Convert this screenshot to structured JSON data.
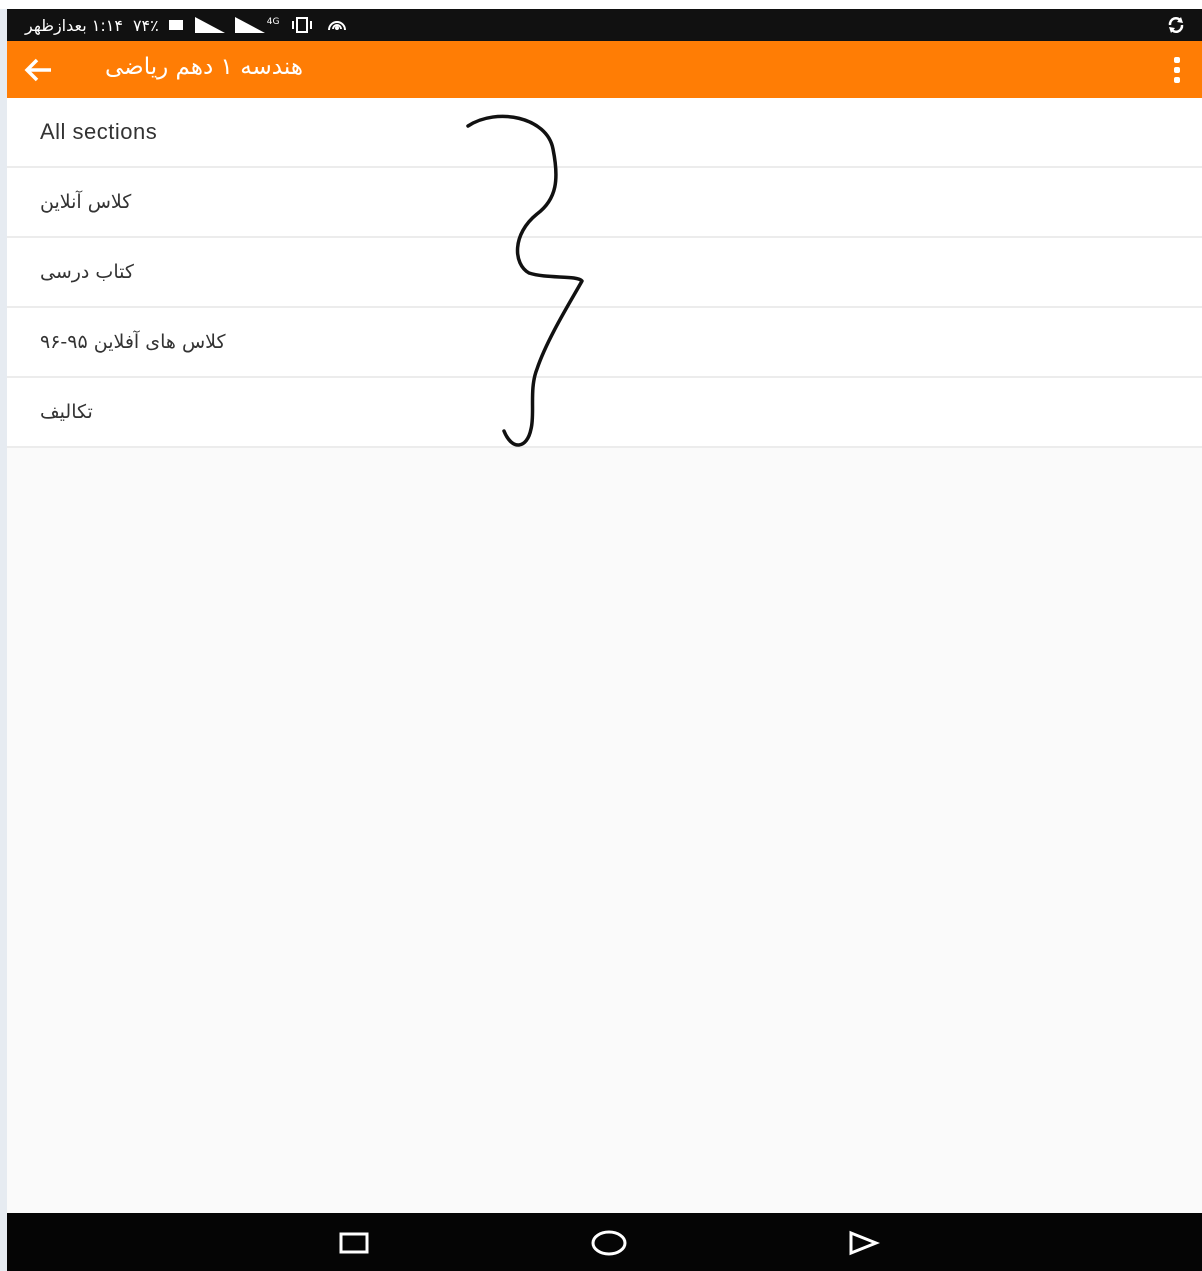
{
  "status_bar": {
    "time": "۱:۱۴ بعدازظهر",
    "battery": "۷۴٪",
    "network": "4G",
    "icons": [
      "battery-icon",
      "signal-icon",
      "signal-4g-icon",
      "vibrate-icon",
      "hotspot-icon",
      "sync-icon"
    ]
  },
  "app_bar": {
    "title": "هندسه ۱ دهم ریاضی",
    "back_icon": "arrow-left-icon",
    "menu_icon": "more-vertical-icon",
    "color": "#ff7d05"
  },
  "sections": [
    {
      "label": "All sections"
    },
    {
      "label": "کلاس آنلاین"
    },
    {
      "label": "کتاب درسی"
    },
    {
      "label": "کلاس های آفلاین ۹۵-۹۶"
    },
    {
      "label": "تکالیف"
    }
  ],
  "nav_bar": {
    "icons": [
      "recents-icon",
      "home-icon",
      "back-triangle-icon"
    ]
  }
}
